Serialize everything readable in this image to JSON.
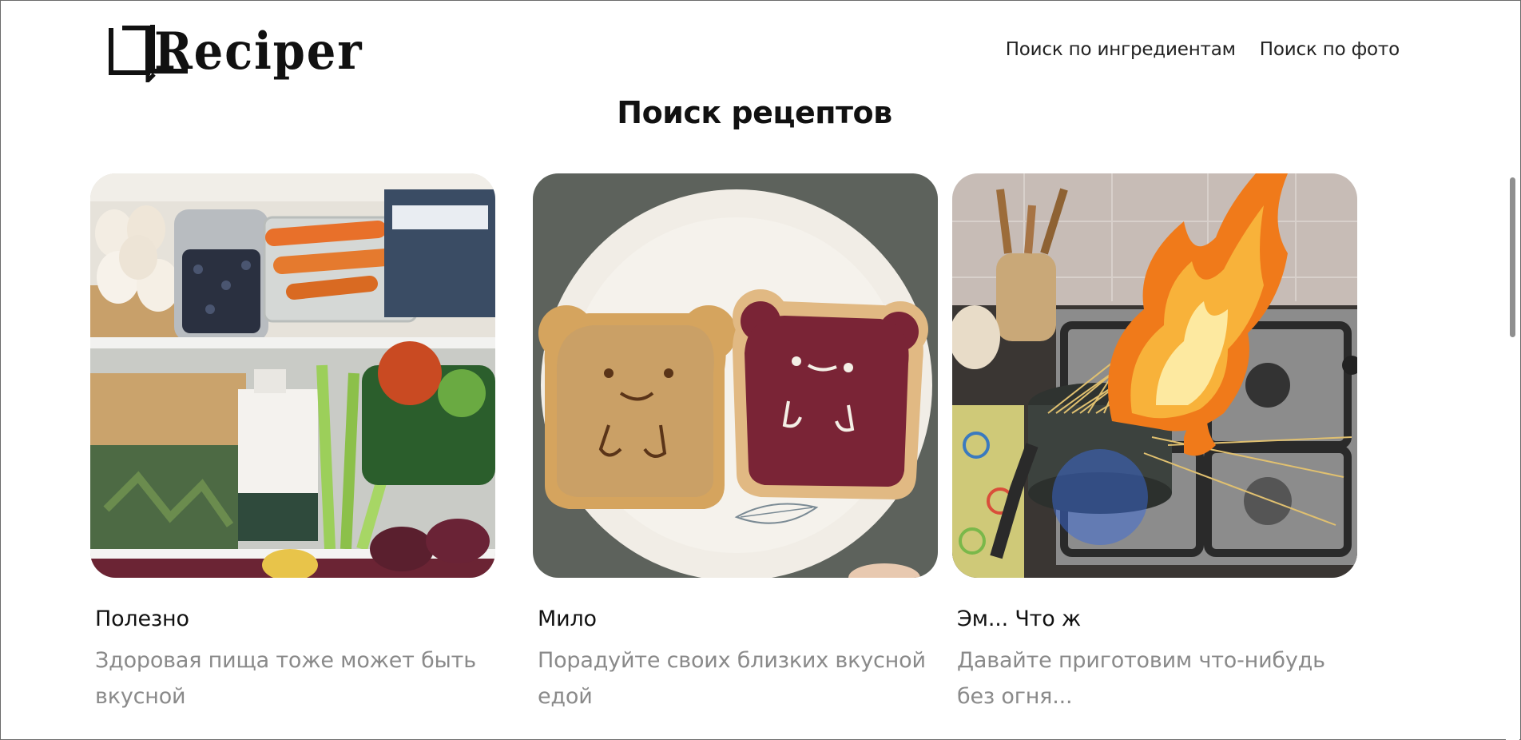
{
  "app": {
    "logo_text": "Reciper",
    "icon": "open-book-logo"
  },
  "nav": {
    "items": [
      {
        "label": "Поиск по ингредиентам"
      },
      {
        "label": "Поиск по фото"
      }
    ]
  },
  "main": {
    "title": "Поиск рецептов",
    "cards": [
      {
        "title": "Полезно",
        "description": "Здоровая пища тоже может быть вкусной",
        "image": "fridge-shelves-photo"
      },
      {
        "title": "Мило",
        "description": "Порадуйте своих близких вкусной едой",
        "image": "bear-toasts-photo"
      },
      {
        "title": "Эм... Что ж",
        "description": "Давайте приготовим что-нибудь без огня...",
        "image": "burning-spaghetti-photo"
      }
    ]
  },
  "colors": {
    "text": "#111111",
    "muted": "#8a8a8a",
    "background": "#ffffff"
  }
}
